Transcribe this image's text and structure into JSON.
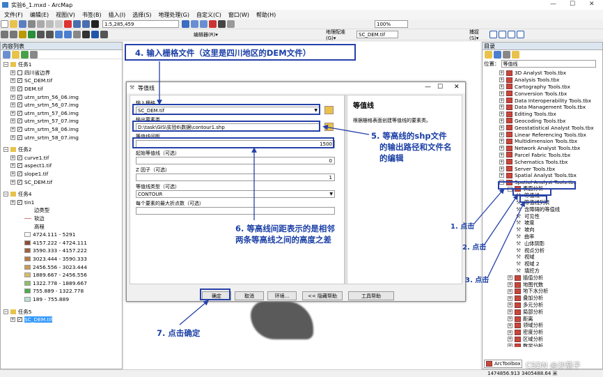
{
  "window": {
    "title": "实验6_1.mxd - ArcMap",
    "controls": [
      "—",
      "☐",
      "✕"
    ]
  },
  "menu": [
    "文件(F)",
    "编辑(E)",
    "视图(V)",
    "书签(B)",
    "插入(I)",
    "选择(S)",
    "地理处理(G)",
    "自定义(C)",
    "窗口(W)",
    "帮助(H)"
  ],
  "toolbar": {
    "scale": "1:5,285,459",
    "zoom": "100%",
    "editor": "编辑器(R)▾",
    "georef": "地理配准(G)▾",
    "georef_layer": "SC_DEM.tif",
    "capture": "捕捉(S)▾"
  },
  "toc": {
    "title": "内容列表",
    "groups": [
      {
        "name": "任务1",
        "layers": [
          {
            "name": "四川省边界",
            "checked": false
          },
          {
            "name": "SC_DEM.tif",
            "checked": true
          },
          {
            "name": "DEM.tif",
            "checked": true
          },
          {
            "name": "utm_srtm_56_06.img",
            "checked": true
          },
          {
            "name": "utm_srtm_56_07.img",
            "checked": true
          },
          {
            "name": "utm_srtm_57_06.img",
            "checked": true
          },
          {
            "name": "utm_srtm_57_07.img",
            "checked": true
          },
          {
            "name": "utm_srtm_58_06.img",
            "checked": true
          },
          {
            "name": "utm_srtm_58_07.img",
            "checked": true
          }
        ]
      },
      {
        "name": "任务2",
        "layers": [
          {
            "name": "curve1.tif",
            "checked": true
          },
          {
            "name": "aspect1.tif",
            "checked": true
          },
          {
            "name": "slope1.tif",
            "checked": true
          },
          {
            "name": "SC_DEM.tif",
            "checked": true
          }
        ]
      },
      {
        "name": "任务4",
        "layers": [
          {
            "name": "tin1",
            "checked": true
          }
        ]
      },
      {
        "name": "任务5",
        "layers": [
          {
            "name": "SC_DEM.tif",
            "checked": true
          }
        ]
      }
    ],
    "tin_legend": {
      "edge_type": "边类型",
      "soft": "软边",
      "elevation": "高程",
      "classes": [
        {
          "label": "4724.111 - 5291",
          "color": "#f7f7f7"
        },
        {
          "label": "4157.222 - 4724.111",
          "color": "#8c4c35"
        },
        {
          "label": "3590.333 - 4157.222",
          "color": "#a0603c"
        },
        {
          "label": "3023.444 - 3590.333",
          "color": "#b57a45"
        },
        {
          "label": "2456.556 - 3023.444",
          "color": "#c99a57"
        },
        {
          "label": "1889.667 - 2456.556",
          "color": "#d9bb6b"
        },
        {
          "label": "1322.778 - 1889.667",
          "color": "#8fbf6a"
        },
        {
          "label": "755.889 - 1322.778",
          "color": "#4fa84e"
        },
        {
          "label": "189 - 755.889",
          "color": "#b7e3d4"
        }
      ]
    }
  },
  "dialog": {
    "title": "等值线",
    "input_label": "输入栅格",
    "input_value": "SC_DEM.tif",
    "output_label": "输出要素类",
    "output_value": "D:\\task\\GIS\\实验6\\数据\\contour1.shp",
    "interval_label": "等值线间距",
    "interval_value": "1500",
    "base_label": "起始等值线（可选）",
    "base_value": "0",
    "z_label": "Z 因子（可选）",
    "z_value": "1",
    "type_label": "等值线类型（可选）",
    "type_value": "CONTOUR",
    "max_label": "每个要素的最大折点数（可选）",
    "help_title": "等值线",
    "help_text": "根据栅格表面创建等值线的要素类。",
    "buttons": {
      "ok": "确定",
      "cancel": "取消",
      "env": "环境...",
      "hide_help": "<< 隐藏帮助",
      "tool_help": "工具帮助"
    }
  },
  "catalog": {
    "title": "目录",
    "location_label": "位置：",
    "location_value": "等值线",
    "items": [
      {
        "name": "3D Analyst Tools.tbx",
        "level": 0
      },
      {
        "name": "Analysis Tools.tbx",
        "level": 0
      },
      {
        "name": "Cartography Tools.tbx",
        "level": 0
      },
      {
        "name": "Conversion Tools.tbx",
        "level": 0
      },
      {
        "name": "Data Interoperability Tools.tbx",
        "level": 0
      },
      {
        "name": "Data Management Tools.tbx",
        "level": 0
      },
      {
        "name": "Editing Tools.tbx",
        "level": 0
      },
      {
        "name": "Geocoding Tools.tbx",
        "level": 0
      },
      {
        "name": "Geostatistical Analyst Tools.tbx",
        "level": 0
      },
      {
        "name": "Linear Referencing Tools.tbx",
        "level": 0
      },
      {
        "name": "Multidimension Tools.tbx",
        "level": 0
      },
      {
        "name": "Network Analyst Tools.tbx",
        "level": 0
      },
      {
        "name": "Parcel Fabric Tools.tbx",
        "level": 0
      },
      {
        "name": "Schematics Tools.tbx",
        "level": 0
      },
      {
        "name": "Server Tools.tbx",
        "level": 0
      },
      {
        "name": "Spatial Analyst Tools.tbx",
        "level": 0
      },
      {
        "name": "Spatial Analyst Tools.tbx",
        "level": 0
      },
      {
        "name": "表面分析",
        "level": 1
      },
      {
        "name": "等值线",
        "level": 2
      },
      {
        "name": "等值线列表",
        "level": 2
      },
      {
        "name": "含障碍的等值线",
        "level": 2
      },
      {
        "name": "可见性",
        "level": 2
      },
      {
        "name": "坡度",
        "level": 2
      },
      {
        "name": "坡向",
        "level": 2
      },
      {
        "name": "曲率",
        "level": 2
      },
      {
        "name": "山体阴影",
        "level": 2
      },
      {
        "name": "视点分析",
        "level": 2
      },
      {
        "name": "视域",
        "level": 2
      },
      {
        "name": "视域 2",
        "level": 2
      },
      {
        "name": "填挖方",
        "level": 2
      },
      {
        "name": "插值分析",
        "level": 1
      },
      {
        "name": "地图代数",
        "level": 1
      },
      {
        "name": "地下水分析",
        "level": 1
      },
      {
        "name": "叠加分析",
        "level": 1
      },
      {
        "name": "多元分析",
        "level": 1
      },
      {
        "name": "局部分析",
        "level": 1
      },
      {
        "name": "距离",
        "level": 1
      },
      {
        "name": "领域分析",
        "level": 1
      },
      {
        "name": "密度分析",
        "level": 1
      },
      {
        "name": "区域分析",
        "level": 1
      },
      {
        "name": "数学分析",
        "level": 1
      }
    ],
    "tab": "ArcToolbox"
  },
  "annotations": {
    "a4": "4. 输入栅格文件（这里是四川地区的DEM文件）",
    "a5_1": "5. 等高线的shp文件",
    "a5_2": "的输出路径和文件名",
    "a5_3": "的编辑",
    "a6_1": "6. 等高线间距表示的是相邻",
    "a6_2": "两条等高线之间的高度之差",
    "a7": "7. 点击确定",
    "c1": "1. 点击",
    "c2": "2. 点击",
    "c3": "3. 点击"
  },
  "status": {
    "coords": "1474856.913  3405488.64 米",
    "watermark": "CSDN @沙茄子"
  },
  "colors": {
    "accent": "#2540a8",
    "highlight": "#3399ff"
  }
}
